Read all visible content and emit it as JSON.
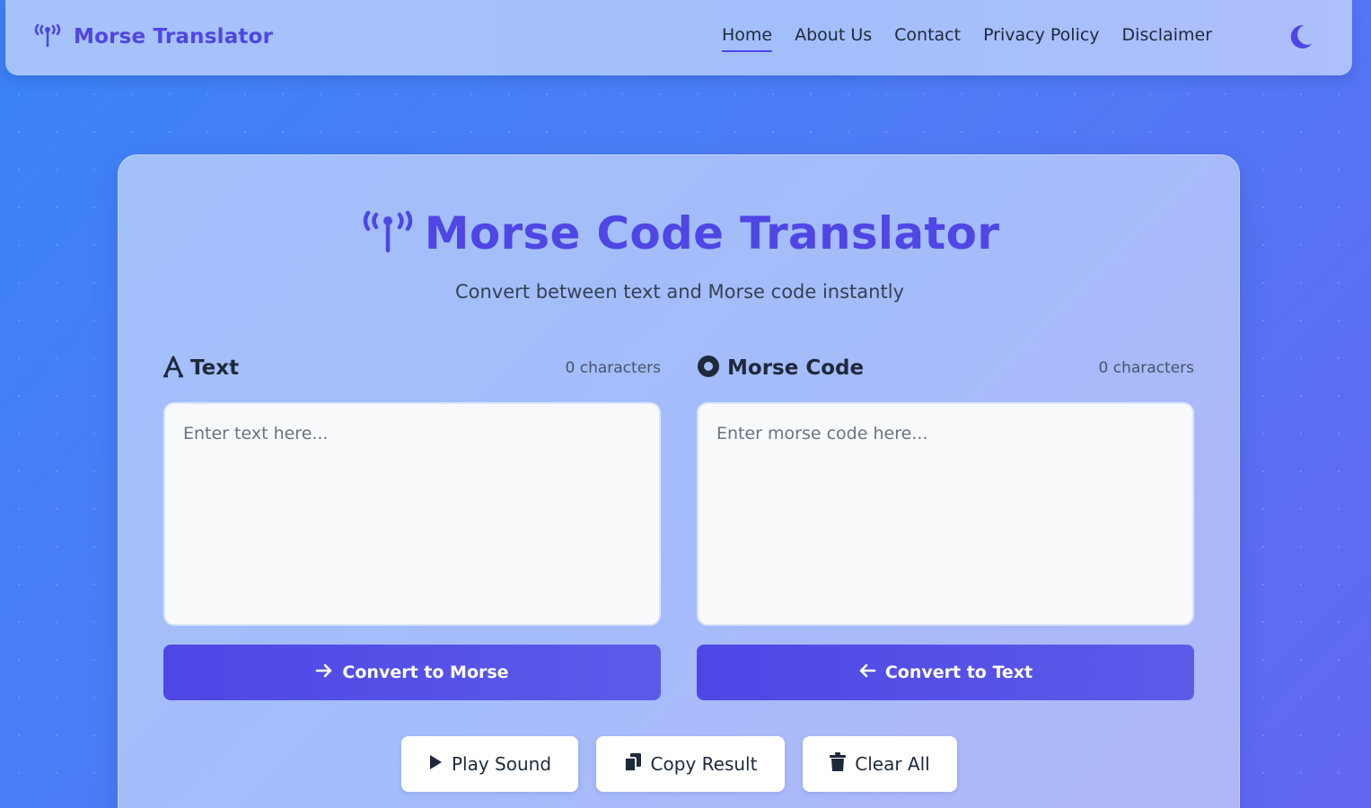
{
  "nav": {
    "brand": "Morse Translator",
    "links": [
      "Home",
      "About Us",
      "Contact",
      "Privacy Policy",
      "Disclaimer"
    ],
    "active": "Home",
    "theme_icon": "moon-icon"
  },
  "main": {
    "title": "Morse Code Translator",
    "subtitle": "Convert between text and Morse code instantly",
    "text_panel": {
      "label": "Text",
      "count": "0 characters",
      "placeholder": "Enter text here...",
      "value": "",
      "button": "Convert to Morse"
    },
    "morse_panel": {
      "label": "Morse Code",
      "count": "0 characters",
      "placeholder": "Enter morse code here...",
      "value": "",
      "button": "Convert to Text"
    },
    "actions": {
      "play": "Play Sound",
      "copy": "Copy Result",
      "clear": "Clear All"
    }
  },
  "colors": {
    "accent": "#4f46e5",
    "text_dark": "#1e293b",
    "background_start": "#3b82f6",
    "background_end": "#6366f1"
  }
}
